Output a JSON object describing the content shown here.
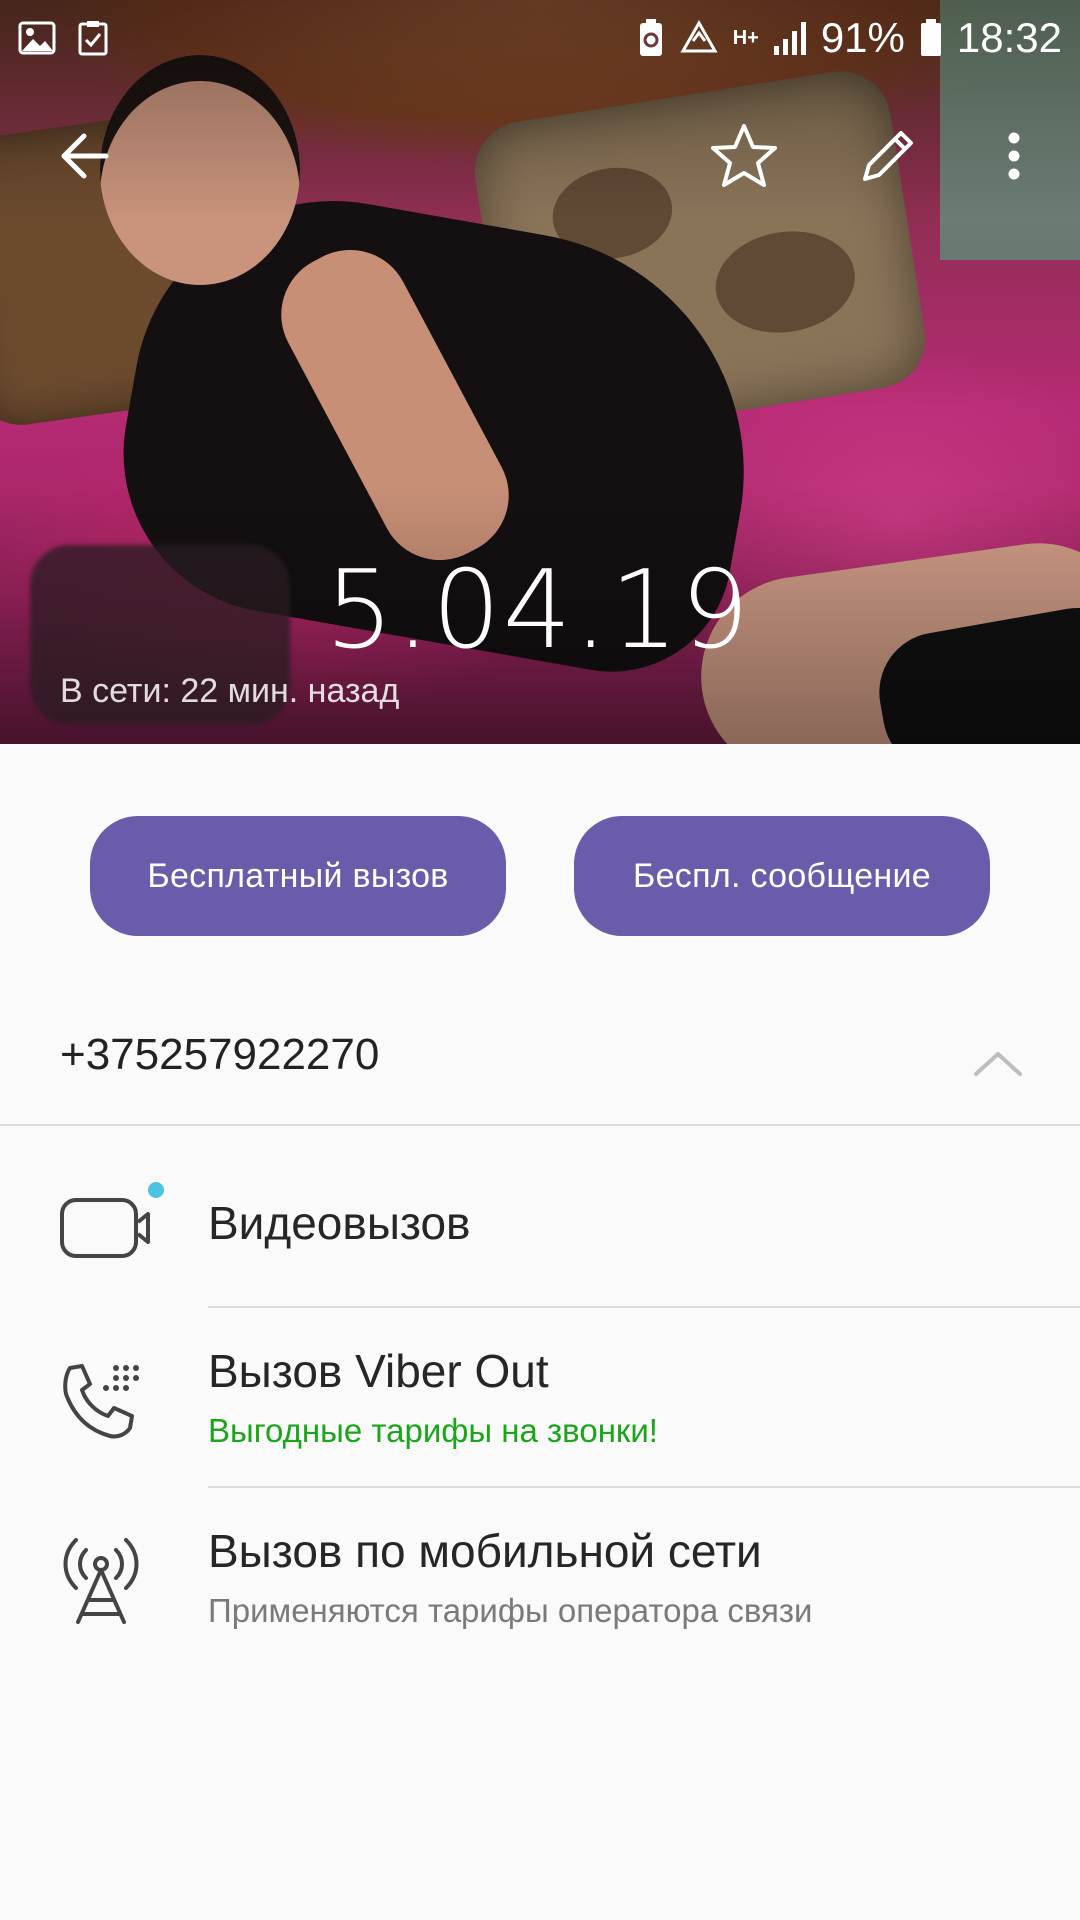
{
  "status_bar": {
    "battery_percent": "91%",
    "time": "18:32",
    "network_type": "H+"
  },
  "header": {
    "contact_title": "5.04.19",
    "last_seen": "В сети: 22 мин. назад"
  },
  "actions": {
    "free_call_label": "Бесплатный вызов",
    "free_message_label": "Беспл. сообщение"
  },
  "contact": {
    "phone_number": "+375257922270"
  },
  "options": [
    {
      "title": "Видеовызов",
      "subtitle": ""
    },
    {
      "title": "Вызов Viber Out",
      "subtitle": "Выгодные тарифы на звонки!"
    },
    {
      "title": "Вызов по мобильной сети",
      "subtitle": "Применяются тарифы оператора связи"
    }
  ],
  "colors": {
    "accent": "#6a5caa",
    "promo_green": "#1aa51a",
    "subtitle_gray": "#7a7a7a",
    "new_dot": "#4fc2dd"
  },
  "icons": [
    "image-icon",
    "clipboard-check-icon",
    "battery-saver-icon",
    "recycle-icon",
    "signal-icon",
    "battery-icon",
    "back-arrow-icon",
    "star-icon",
    "pencil-icon",
    "more-vert-icon",
    "chevron-up-icon",
    "video-camera-icon",
    "phone-dialpad-icon",
    "cell-tower-icon"
  ]
}
